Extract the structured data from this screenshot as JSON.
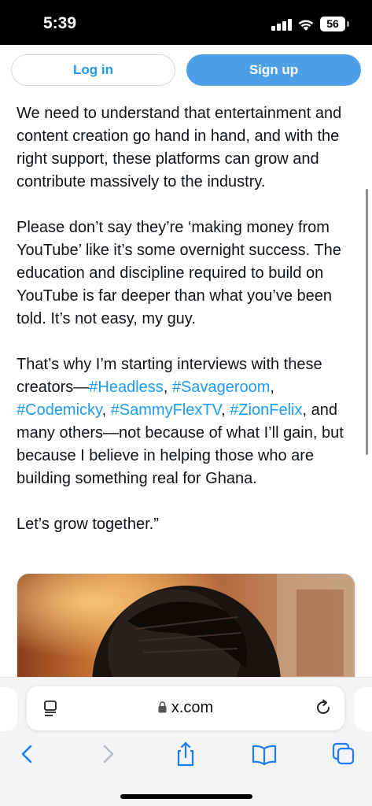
{
  "status_bar": {
    "time": "5:39",
    "battery": "56",
    "icons": [
      "signal-icon",
      "wifi-icon",
      "battery-icon"
    ]
  },
  "auth": {
    "login_label": "Log in",
    "signup_label": "Sign up"
  },
  "article": {
    "paragraph1": "We need to understand that entertainment and content creation go hand in hand, and with the right support, these platforms can grow and contribute massively to the industry.",
    "paragraph2": "Please don’t say they’re ‘making money from YouTube’ like it’s some overnight success. The education and discipline required to build on YouTube is far deeper than what you’ve been told. It’s not easy, my guy.",
    "paragraph3": {
      "prefix": "That’s why I’m starting interviews with these creators—",
      "hashtags": [
        "#Headless",
        "#Savageroom",
        "#Codemicky",
        "#SammyFlexTV",
        "#ZionFelix"
      ],
      "sep1": ", ",
      "suffix": ", and many others—not because of what I’ll gain, but because I believe in helping those who are building something real for Ghana."
    },
    "paragraph4": "Let’s grow together.”"
  },
  "browser": {
    "url": "x.com",
    "icons": [
      "reader-icon",
      "lock-icon",
      "reload-icon",
      "back-icon",
      "forward-icon",
      "share-icon",
      "bookmarks-icon",
      "tabs-icon"
    ]
  },
  "colors": {
    "link": "#1d9bf0",
    "signup_bg": "#4d9fe8",
    "toolbar_accent": "#1b7cf5"
  }
}
